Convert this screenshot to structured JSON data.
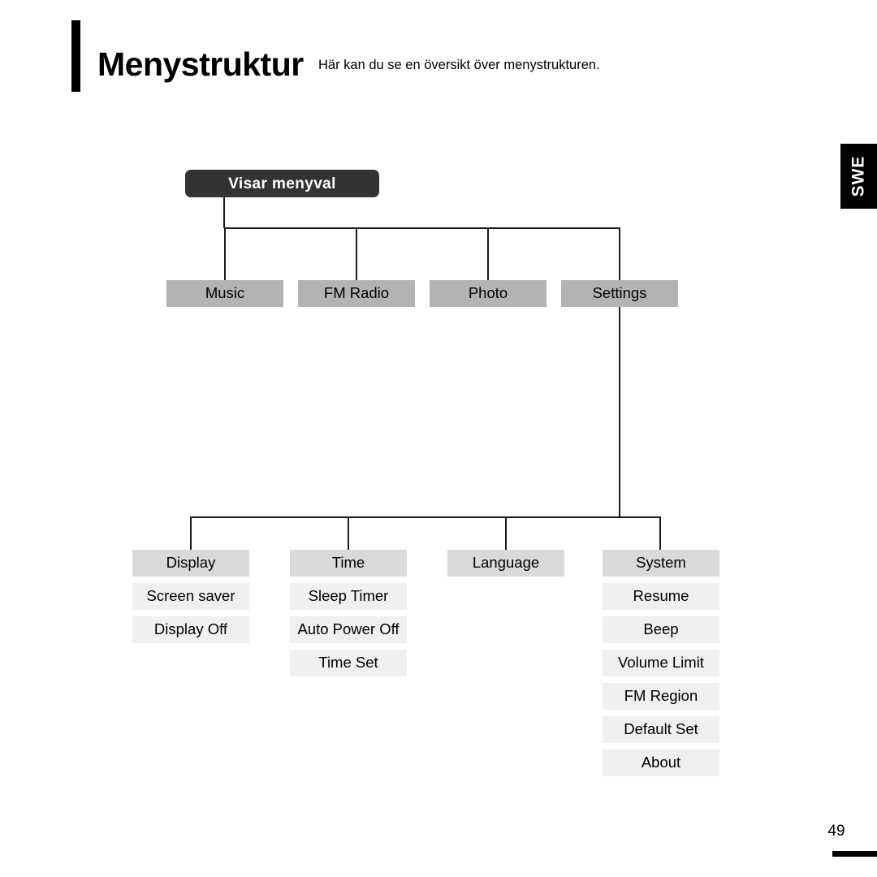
{
  "header": {
    "title": "Menystruktur",
    "subtitle": "Här kan du se en översikt över menystrukturen."
  },
  "language_tab": {
    "label": "SWE"
  },
  "footer": {
    "page_number": "49"
  },
  "colors": {
    "root_background": "#333333",
    "root_text": "#ffffff",
    "level1_background": "#b3b3b3",
    "level2_background": "#dadada",
    "level3_background": "#f0f0f0",
    "connector": "#1a1a1a",
    "tab_background": "#000000",
    "page_background": "#ffffff"
  },
  "diagram": {
    "type": "tree",
    "root": {
      "label": "Visar menyval"
    },
    "level1": [
      {
        "label": "Music"
      },
      {
        "label": "FM Radio"
      },
      {
        "label": "Photo"
      },
      {
        "label": "Settings"
      }
    ],
    "level2": [
      {
        "label": "Display",
        "children": [
          {
            "label": "Screen saver"
          },
          {
            "label": "Display Off"
          }
        ]
      },
      {
        "label": "Time",
        "children": [
          {
            "label": "Sleep Timer"
          },
          {
            "label": "Auto Power Off"
          },
          {
            "label": "Time Set"
          }
        ]
      },
      {
        "label": "Language",
        "children": []
      },
      {
        "label": "System",
        "children": [
          {
            "label": "Resume"
          },
          {
            "label": "Beep"
          },
          {
            "label": "Volume Limit"
          },
          {
            "label": "FM Region"
          },
          {
            "label": "Default Set"
          },
          {
            "label": "About"
          }
        ]
      }
    ]
  }
}
